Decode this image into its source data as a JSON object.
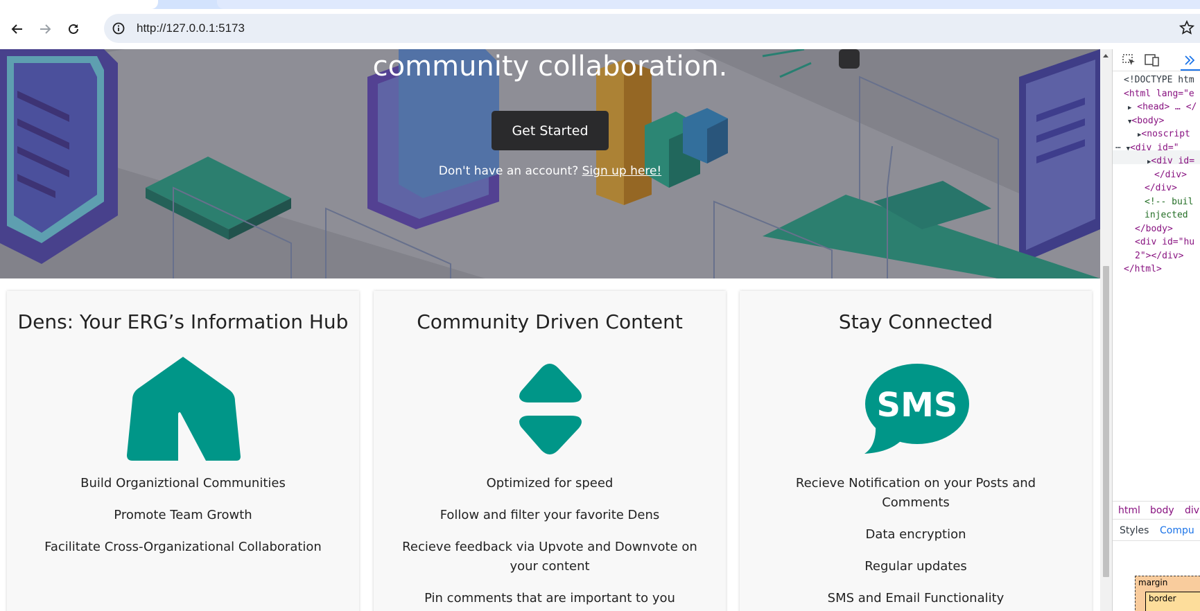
{
  "browser": {
    "url": "http://127.0.0.1:5173"
  },
  "hero": {
    "title": "community collaboration.",
    "cta_label": "Get Started",
    "signup_prompt": "Don't have an account?",
    "signup_link": "Sign up here!"
  },
  "cards": [
    {
      "title": "Dens: Your ERG’s Information Hub",
      "icon": "tent-icon",
      "items": [
        "Build Organiztional Communities",
        "Promote Team Growth",
        "Facilitate Cross-Organizational Collaboration"
      ]
    },
    {
      "title": "Community Driven Content",
      "icon": "sort-arrows-icon",
      "items": [
        "Optimized for speed",
        "Follow and filter your favorite Dens",
        "Recieve feedback via Upvote and Downvote on your content",
        "Pin comments that are important to you"
      ]
    },
    {
      "title": "Stay Connected",
      "icon": "sms-bubble-icon",
      "sms_label": "SMS",
      "items": [
        "Recieve Notification on your Posts and Comments",
        "Data encryption",
        "Regular updates",
        "SMS and Email Functionality"
      ]
    }
  ],
  "devtools": {
    "dom": [
      {
        "text": "<!DOCTYPE htm"
      },
      {
        "text": "<html lang=\"e"
      },
      {
        "text": "<head> … </"
      },
      {
        "text": "<body>"
      },
      {
        "text": "<noscript"
      },
      {
        "text": "<div id=\""
      },
      {
        "text": "<div id="
      },
      {
        "text": "</div>"
      },
      {
        "text": "</div>"
      },
      {
        "text": "<!-- buil"
      },
      {
        "text": "injected"
      },
      {
        "text": "</body>"
      },
      {
        "text": "<div id=\"hu"
      },
      {
        "text": "2\"></div>"
      },
      {
        "text": "</html>"
      }
    ],
    "crumbs": [
      "html",
      "body",
      "div"
    ],
    "tabs": [
      "Styles",
      "Compu"
    ],
    "box_model": {
      "margin": "margin",
      "border": "border"
    }
  },
  "colors": {
    "accent": "#009688",
    "button_dark": "#2a2a2c",
    "card_bg": "#f8f8f8"
  }
}
